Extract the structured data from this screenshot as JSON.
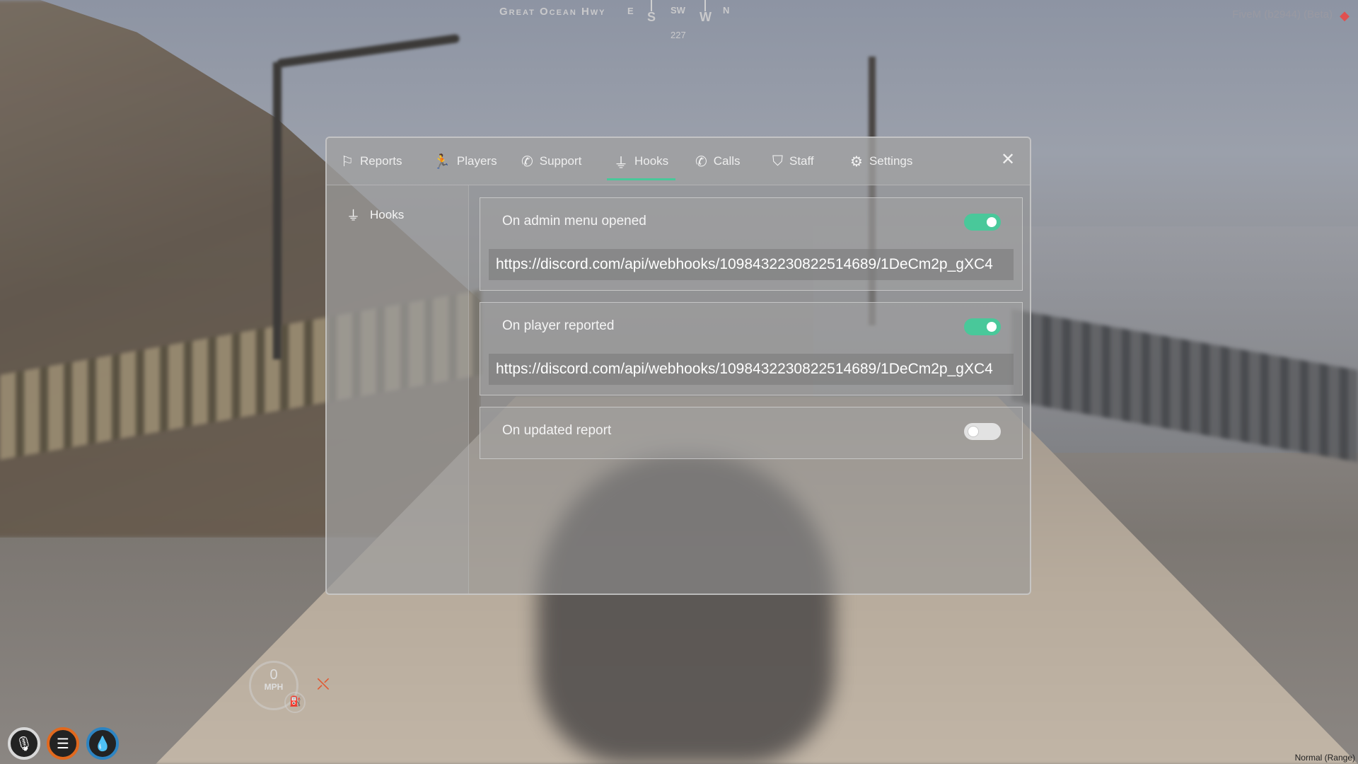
{
  "hud": {
    "street": "Great Ocean Hwy",
    "compass": {
      "e": "E",
      "s": "S",
      "sw": "SW",
      "w": "W",
      "nw": "N",
      "heading": "227"
    },
    "build": "FiveM (b2944) (Beta)",
    "speed": "0",
    "speed_unit": "MPH",
    "mode": "Normal (Range)"
  },
  "tabs": [
    {
      "label": "Reports",
      "icon": "flag-icon"
    },
    {
      "label": "Players",
      "icon": "running-person-icon"
    },
    {
      "label": "Support",
      "icon": "phone-icon"
    },
    {
      "label": "Hooks",
      "icon": "plug-icon"
    },
    {
      "label": "Calls",
      "icon": "phone-icon"
    },
    {
      "label": "Staff",
      "icon": "shield-icon"
    },
    {
      "label": "Settings",
      "icon": "gears-icon"
    }
  ],
  "active_tab": "Hooks",
  "sidebar": {
    "items": [
      {
        "label": "Hooks",
        "icon": "plug-icon"
      }
    ]
  },
  "hooks": [
    {
      "title": "On admin menu opened",
      "enabled": true,
      "url": "https://discord.com/api/webhooks/1098432230822514689/1DeCm2p_gXC4"
    },
    {
      "title": "On player reported",
      "enabled": true,
      "url": "https://discord.com/api/webhooks/1098432230822514689/1DeCm2p_gXC4"
    },
    {
      "title": "On updated report",
      "enabled": false
    }
  ],
  "colors": {
    "accent": "#49c89a",
    "toggle_off": "#e2e2e2",
    "food_ring": "#e1691e",
    "water_ring": "#2d84c2",
    "seatbelt": "#e15a33"
  }
}
